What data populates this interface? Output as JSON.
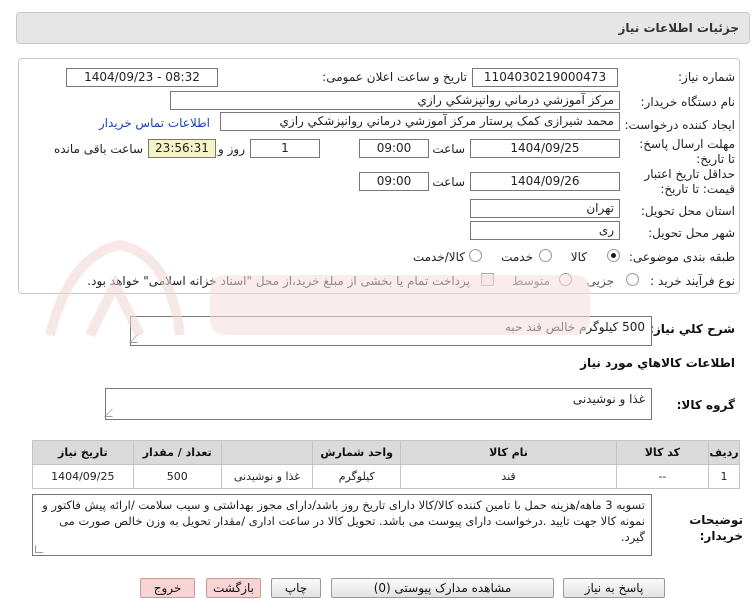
{
  "header": {
    "title": "جزئیات اطلاعات نیاز"
  },
  "form": {
    "need_number_label": "شماره نیاز:",
    "need_number": "1104030219000473",
    "announce_label": "تاریخ و ساعت اعلان عمومی:",
    "announce_value": "1404/09/23 - 08:32",
    "buyer_org_label": "نام دستگاه خریدار:",
    "buyer_org": "مرکز آموزشي درماني روانپزشكي رازي",
    "requester_label": "ایجاد کننده درخواست:",
    "requester": "محمد شیرازی کمک پرستار مرکز آموزشي درماني روانپزشكي رازي",
    "contact_link": "اطلاعات تماس خریدار",
    "reply_deadline_label": "مهلت ارسال پاسخ: تا تاریخ:",
    "reply_date": "1404/09/25",
    "time_label": "ساعت",
    "reply_time": "09:00",
    "days": "1",
    "days_label": "روز و",
    "remaining_time": "23:56:31",
    "remaining_label": "ساعت باقی مانده",
    "price_validity_label": "حداقل تاریخ اعتبار قیمت: تا تاریخ:",
    "validity_date": "1404/09/26",
    "validity_time": "09:00",
    "province_label": "استان محل تحویل:",
    "province": "تهران",
    "city_label": "شهر محل تحویل:",
    "city": "ری",
    "category_label": "طبقه بندی موضوعی:",
    "category_options": [
      "کالا",
      "خدمت",
      "کالا/خدمت"
    ],
    "process_label": "نوع فرآیند خرید :",
    "process_options": [
      "جزیی",
      "متوسط"
    ],
    "payment_note": "پرداخت تمام یا بخشی از مبلغ خرید،از محل \"اسناد خزانه اسلامی\" خواهد بود."
  },
  "need": {
    "summary_label": "شرح کلي نياز:",
    "summary": "500 کیلوگرم خالص قند حبه",
    "goods_info_title": "اطلاعات کالاهاي مورد نياز",
    "group_label": "گروه کالا:",
    "group": "غذا و نوشیدنی"
  },
  "table": {
    "headers": [
      "ردیف",
      "کد کالا",
      "نام کالا",
      "واحد شمارش",
      "تعداد / مقدار",
      "تاریخ نیاز"
    ],
    "rows": [
      [
        "1",
        "--",
        "قند",
        "کیلوگرم",
        "500",
        "1404/09/25"
      ]
    ],
    "extra_col": "غذا و نوشیدنی"
  },
  "buyer_desc": {
    "label": "توضیحات خریدار:",
    "text": "تسویه 3 ماهه/هزینه حمل با تامین کننده کالا/کالا دارای تاریخ روز باشد/دارای مجوز بهداشتی و سیب سلامت /ارائه پیش فاکتور و نمونه کالا جهت تایید .درخواست دارای پیوست می باشد. تحویل کالا در ساعت اداری /مقدار تحویل به وزن خالص صورت می گیرد."
  },
  "buttons": {
    "reply": "پاسخ به نیاز",
    "view_docs": "مشاهده مدارک پیوستی (0)",
    "print": "چاپ",
    "back": "بازگشت",
    "exit": "خروج"
  },
  "colors": {
    "yellow_field": "#f6f4c6",
    "link": "#1a44b8",
    "red_button": "#f7d4d4"
  }
}
